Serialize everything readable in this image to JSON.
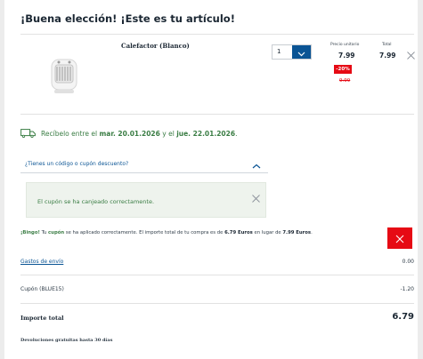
{
  "header": {
    "title": "¡Buena elección! ¡Este es tu artículo!"
  },
  "product": {
    "name": "Calefactor (Blanco)",
    "quantity": "1",
    "unit_price_label": "Precio unitario",
    "unit_price": "7.99",
    "discount_badge": "-20%",
    "old_price": "9.99",
    "total_label": "Total",
    "total": "7.99"
  },
  "delivery": {
    "prefix": "Recíbelo entre el",
    "date_from": "mar. 20.01.2026",
    "middle": "y el",
    "date_to": "jue. 22.01.2026",
    "suffix": "."
  },
  "coupon": {
    "toggle_label": "¿Tienes un código o cupón descuento?",
    "success_message": "El cupón se ha canjeado correctamente."
  },
  "bingo": {
    "lead": "¡Bingo!",
    "t1": " Tu ",
    "coupon_word": "cupón",
    "t2": " se ha aplicado correctamente. El importe total de tu compra es de ",
    "new_total": "6.79 Euros",
    "t3": " en lugar de ",
    "old_total": "7.99 Euros",
    "t4": "."
  },
  "summary": {
    "shipping_label": "Gastos de envío",
    "shipping_value": "0.00",
    "coupon_label": "Cupón (BLUE15)",
    "coupon_value": "-1.20",
    "total_label": "Importe total",
    "total_value": "6.79",
    "returns_note": "Devoluciones gratuitas hasta 30 días"
  },
  "colors": {
    "accent_blue": "#0a5494",
    "sale_red": "#e60a14",
    "success_green": "#3a7d44"
  },
  "icons": [
    "chevron-down-icon",
    "close-icon",
    "truck-icon",
    "chevron-up-icon",
    "heater-image"
  ]
}
